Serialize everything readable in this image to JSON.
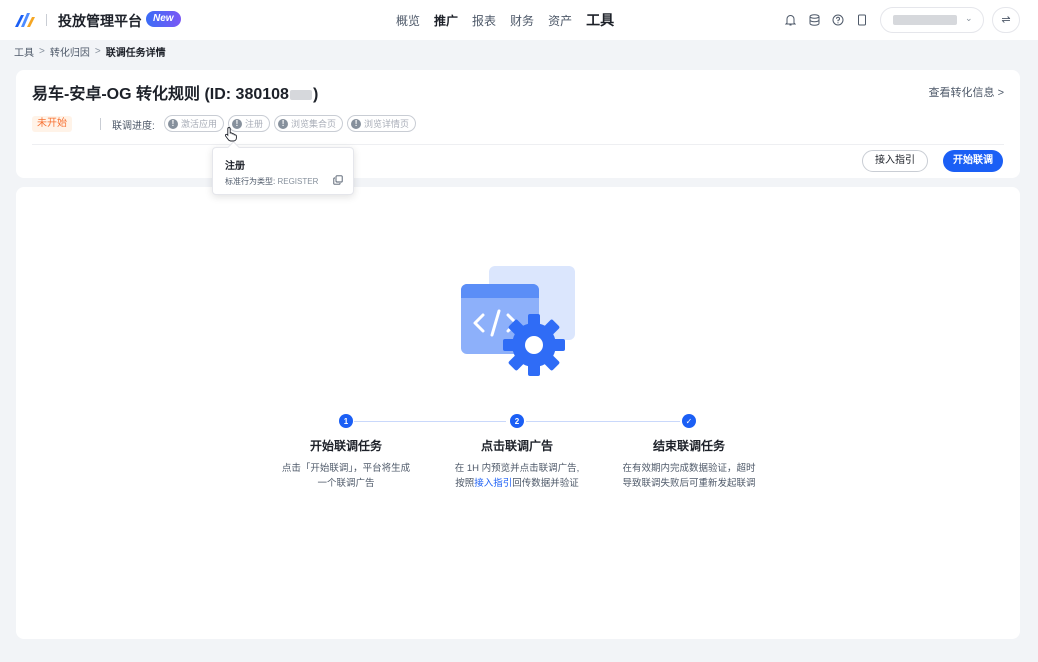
{
  "nav": {
    "platform_title": "投放管理平台",
    "new_badge": "New",
    "menu": [
      {
        "label": "概览"
      },
      {
        "label": "推广"
      },
      {
        "label": "报表"
      },
      {
        "label": "财务"
      },
      {
        "label": "资产"
      },
      {
        "label": "工具"
      }
    ],
    "icons": [
      "bell-icon",
      "database-icon",
      "help-icon",
      "bookmark-icon"
    ],
    "switch_label": "⇌"
  },
  "breadcrumb": {
    "items": [
      "工具",
      "转化归因",
      "联调任务详情"
    ],
    "separator": ">"
  },
  "header": {
    "rule_title": "易车-安卓-OG 转化规则 (ID: 380108",
    "rule_title_end": ")",
    "view_info": "查看转化信息",
    "view_info_chevron": ">",
    "status": "未开始",
    "progress_label": "联调进度:",
    "steps": [
      {
        "label": "激活应用",
        "mark": "!"
      },
      {
        "label": "注册",
        "mark": "!"
      },
      {
        "label": "浏览集合页",
        "mark": "!"
      },
      {
        "label": "浏览详情页",
        "mark": "!"
      }
    ],
    "guide_button": "接入指引",
    "start_button": "开始联调"
  },
  "tooltip": {
    "title": "注册",
    "desc_label": "标准行为类型:",
    "desc_code": "REGISTER"
  },
  "flow": {
    "steps": [
      {
        "number": "1",
        "title": "开始联调任务",
        "desc_line1": "点击「开始联调」，平台将生成",
        "desc_line2": "一个联调广告"
      },
      {
        "number": "2",
        "title": "点击联调广告",
        "desc_line1": "在 1H 内预览并点击联调广告,",
        "desc_line2_prefix": "按照",
        "desc_link": "接入指引",
        "desc_line2_suffix": "回传数据并验证"
      },
      {
        "number": "✓",
        "title": "结束联调任务",
        "desc_line1": "在有效期内完成数据验证，超时",
        "desc_line2": "导致联调失败后可重新发起联调"
      }
    ]
  },
  "colors": {
    "primary": "#1b5ff5",
    "status_warn": "#f77234",
    "background": "#f2f4f7"
  }
}
